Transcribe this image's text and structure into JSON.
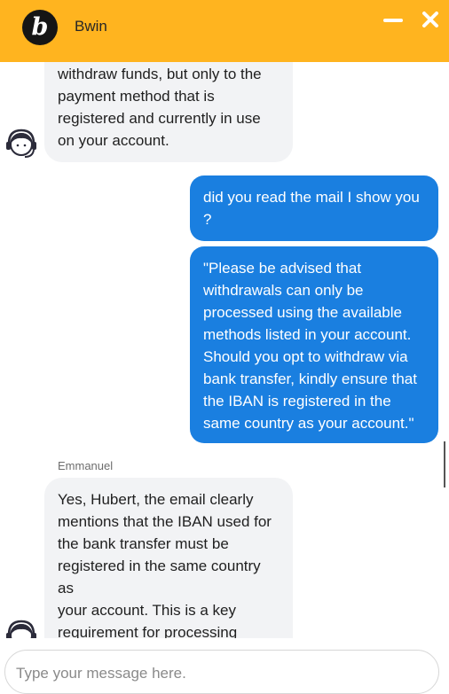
{
  "header": {
    "logo_letter": "b",
    "title": "Bwin"
  },
  "messages": [
    {
      "from": "agent",
      "text": "withdraw funds, but only to the\npayment method that is\nregistered and currently in use\non your account."
    },
    {
      "from": "user",
      "text": "did you read the mail I show you\n?"
    },
    {
      "from": "user",
      "text": "\"Please be advised that\nwithdrawals can only be\nprocessed using the available\nmethods listed in your account.\nShould you opt to withdraw via\nbank transfer, kindly ensure that\nthe IBAN is registered in the\nsame country as your account.\""
    },
    {
      "from": "agent",
      "sender": "Emmanuel",
      "text": "Yes, Hubert, the email clearly\nmentions that the IBAN used for\nthe bank transfer must be\nregistered in the same country as\nyour account. This is a key\nrequirement for processing\nwithdrawals via bank transfer."
    }
  ],
  "composer": {
    "placeholder": "Type your message here."
  },
  "colors": {
    "header": "#ffb41f",
    "user_bubble": "#1a7fe0",
    "agent_bubble": "#f2f3f5"
  },
  "icons": {
    "logo": "bwin-logo-icon",
    "minimize": "minimize-icon",
    "close": "close-icon",
    "agent_avatar": "support-agent-headset-icon"
  }
}
